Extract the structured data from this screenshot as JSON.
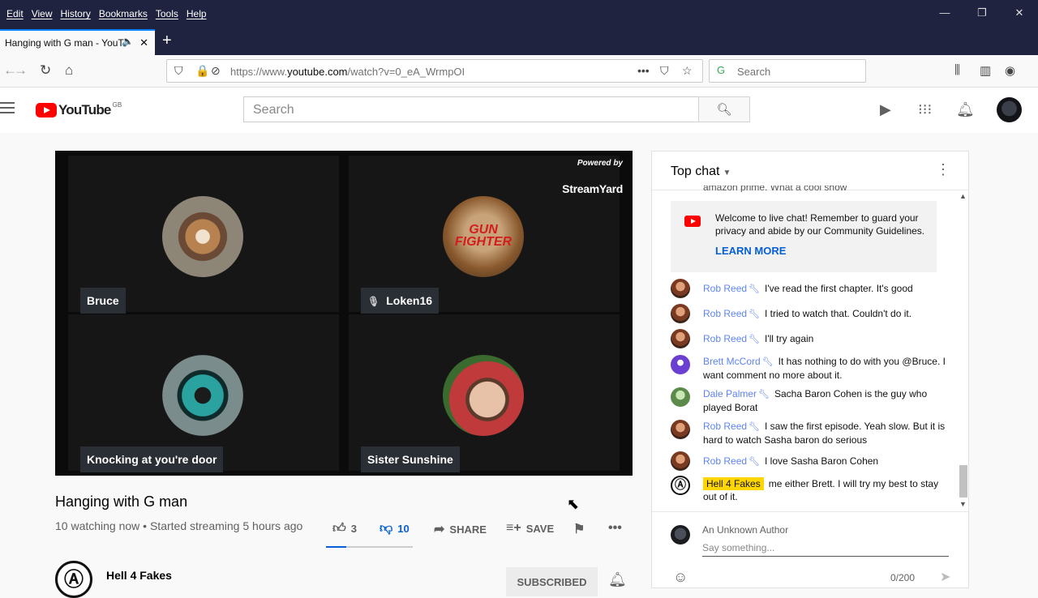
{
  "browser": {
    "menu": [
      "Edit",
      "View",
      "History",
      "Bookmarks",
      "Tools",
      "Help"
    ],
    "window_controls": [
      "—",
      "❐",
      "✕"
    ],
    "tab_title": "Hanging with G man - YouT",
    "url_prefix": "https://www.",
    "url_domain": "youtube.com",
    "url_path": "/watch?v=0_eA_WrmpOI",
    "search_placeholder": "Search"
  },
  "youtube": {
    "logo_text": "YouTube",
    "region": "GB",
    "search_placeholder": "Search"
  },
  "video": {
    "powered_by": "Powered by",
    "brand": "StreamYard",
    "participants": [
      {
        "name": "Bruce",
        "muted": false
      },
      {
        "name": "Loken16",
        "muted": true
      },
      {
        "name": "Knocking at you're door",
        "muted": false
      },
      {
        "name": "Sister Sunshine",
        "muted": false
      }
    ],
    "gun_fighter_text": "GUN FIGHTER",
    "title": "Hanging with G man",
    "meta": "10 watching now • Started streaming 5 hours ago",
    "likes": "3",
    "dislikes": "10",
    "share_label": "SHARE",
    "save_label": "SAVE",
    "like_ratio": 0.23
  },
  "channel": {
    "name": "Hell 4 Fakes",
    "subscribe_label": "SUBSCRIBED"
  },
  "chat": {
    "header": "Top chat",
    "cutoff_text": "amazon prime. What a cool show",
    "welcome": "Welcome to live chat! Remember to guard your privacy and abide by our Community Guidelines.",
    "learn_more": "LEARN MORE",
    "messages": [
      {
        "author": "Rob Reed",
        "text": "I've read the first chapter. It's good"
      },
      {
        "author": "Rob Reed",
        "text": "I tried to watch that. Couldn't do it."
      },
      {
        "author": "Rob Reed",
        "text": "I'll try again"
      },
      {
        "author": "Brett McCord",
        "text": "It has nothing to do with you @Bruce. I want comment no more about it."
      },
      {
        "author": "Dale Palmer",
        "text": "Sacha Baron Cohen is the guy who played Borat"
      },
      {
        "author": "Rob Reed",
        "text": "I saw the first episode. Yeah slow. But it is hard to watch Sasha baron do serious"
      },
      {
        "author": "Rob Reed",
        "text": "I love Sasha Baron Cohen"
      },
      {
        "author": "Hell 4 Fakes",
        "text": "me either Brett. I will try my best to stay out of it."
      }
    ],
    "input_author": "An Unknown Author",
    "input_placeholder": "Say something...",
    "char_count": "0/200"
  },
  "colors": {
    "chrome_dark": "#202340",
    "yt_red": "#ff0000",
    "link_blue": "#065fd4",
    "moderator_blue": "#5e84f1",
    "owner_badge": "#ffd600"
  }
}
